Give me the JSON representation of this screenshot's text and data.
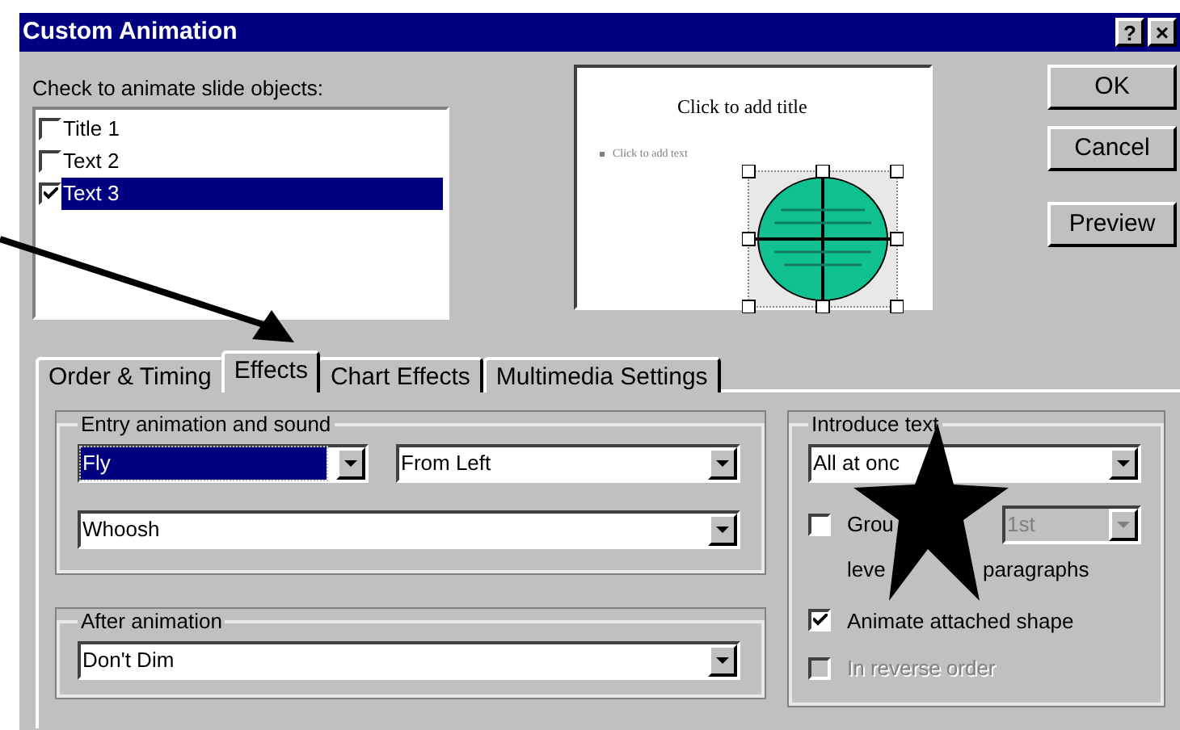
{
  "window": {
    "title": "Custom Animation",
    "help": "?",
    "close": "×"
  },
  "objects": {
    "label": "Check to animate slide objects:",
    "items": [
      {
        "label": "Title 1",
        "checked": false,
        "selected": false
      },
      {
        "label": "Text 2",
        "checked": false,
        "selected": false
      },
      {
        "label": "Text 3",
        "checked": true,
        "selected": true
      }
    ]
  },
  "preview": {
    "title": "Click to add title",
    "bullet": "Click to add text"
  },
  "buttons": [
    {
      "label": "OK"
    },
    {
      "label": "Cancel"
    },
    {
      "label": "Preview"
    }
  ],
  "tabs": [
    {
      "label": "Order & Timing",
      "selected": false
    },
    {
      "label": "Effects",
      "selected": true
    },
    {
      "label": "Chart Effects",
      "selected": false
    },
    {
      "label": "Multimedia Settings",
      "selected": false
    }
  ],
  "entry": {
    "title": "Entry animation and sound",
    "effect": {
      "value": "Fly",
      "focused": true
    },
    "direction": {
      "value": "From Left",
      "focused": false
    },
    "sound": {
      "value": "Whoosh",
      "focused": false
    }
  },
  "after": {
    "title": "After animation",
    "value": {
      "value": "Don't Dim",
      "focused": false
    }
  },
  "introduce": {
    "title": "Introduce text",
    "mode": "All at onc",
    "group": {
      "label": "Grou",
      "checked": false,
      "by_level": "1st",
      "by_level_disabled": true,
      "line_2a": "leve",
      "line_2b": "paragraphs"
    },
    "options": [
      {
        "label": "Animate attached shape",
        "checked": true,
        "disabled": false
      },
      {
        "label": "In reverse order",
        "checked": false,
        "disabled": true
      }
    ]
  }
}
